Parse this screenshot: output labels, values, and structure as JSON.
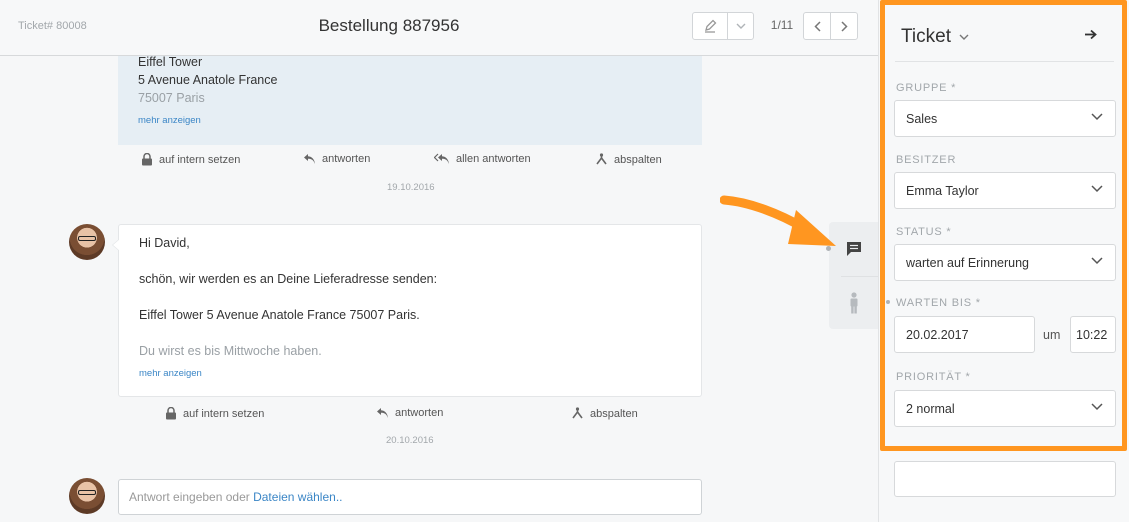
{
  "header": {
    "ticket_number": "Ticket# 80008",
    "title": "Bestellung 887956",
    "pager": "1/11"
  },
  "article1": {
    "lines": [
      "Eiffel Tower",
      "5 Avenue Anatole France",
      "75007 Paris"
    ],
    "more_link": "mehr anzeigen"
  },
  "actions1": {
    "internal": "auf intern setzen",
    "reply": "antworten",
    "reply_all": "allen antworten",
    "split": "abspalten"
  },
  "date1": "19.10.2016",
  "article2": {
    "greeting": "Hi David,",
    "line1": "schön, wir werden es an Deine Lieferadresse senden:",
    "line2": "Eiffel Tower 5 Avenue Anatole France 75007 Paris.",
    "line3": "Du wirst es bis Mittwoche haben.",
    "more_link": "mehr anzeigen"
  },
  "actions2": {
    "internal": "auf intern setzen",
    "reply": "antworten",
    "split": "abspalten"
  },
  "date2": "20.10.2016",
  "reply_box": {
    "placeholder": "Antwort eingeben oder",
    "link": "Dateien wählen.."
  },
  "sidebar": {
    "title": "Ticket",
    "group_label": "GRUPPE *",
    "group_value": "Sales",
    "owner_label": "BESITZER",
    "owner_value": "Emma Taylor",
    "status_label": "STATUS *",
    "status_value": "warten auf Erinnerung",
    "pending_label": "WARTEN BIS *",
    "pending_date": "20.02.2017",
    "pending_at": "um",
    "pending_time": "10:22",
    "priority_label": "PRIORITÄT *",
    "priority_value": "2 normal"
  },
  "colors": {
    "highlight": "#ff9620",
    "arrow": "#ff9620",
    "link": "#3b86c6",
    "article_internal_bg": "#e6eef4"
  },
  "icons": [
    "pencil-icon",
    "chevron-down-icon",
    "chevron-left-icon",
    "chevron-right-icon",
    "lock-icon",
    "reply-icon",
    "reply-all-icon",
    "split-icon",
    "chat-icon",
    "person-icon",
    "arrow-right-icon",
    "orange-pointer-arrow"
  ]
}
